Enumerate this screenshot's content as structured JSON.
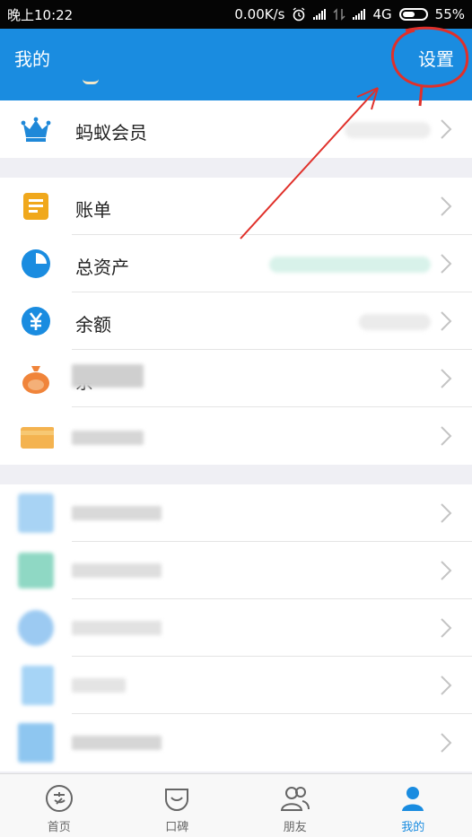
{
  "status_bar": {
    "time": "晚上10:22",
    "speed": "0.00K/s",
    "network": "4G",
    "battery": "55%"
  },
  "header": {
    "title": "我的",
    "settings": "设置"
  },
  "vip": {
    "label": "蚂蚁会员"
  },
  "finance": [
    {
      "label": "账单",
      "icon": "bill-icon"
    },
    {
      "label": "总资产",
      "icon": "pie-chart-icon"
    },
    {
      "label": "余额",
      "icon": "yuan-icon"
    },
    {
      "label": "余",
      "icon": "money-bag-icon"
    },
    {
      "label": "",
      "icon": "card-icon"
    }
  ],
  "tabs": [
    {
      "label": "首页",
      "icon": "alipay-icon"
    },
    {
      "label": "口碑",
      "icon": "koubei-icon"
    },
    {
      "label": "朋友",
      "icon": "friends-icon"
    },
    {
      "label": "我的",
      "icon": "me-icon"
    }
  ],
  "colors": {
    "primary": "#1a8ce0",
    "annotation": "#e0302a",
    "bill": "#f0a81c",
    "vip": "#1f88d8",
    "moneybag": "#f0843a"
  }
}
